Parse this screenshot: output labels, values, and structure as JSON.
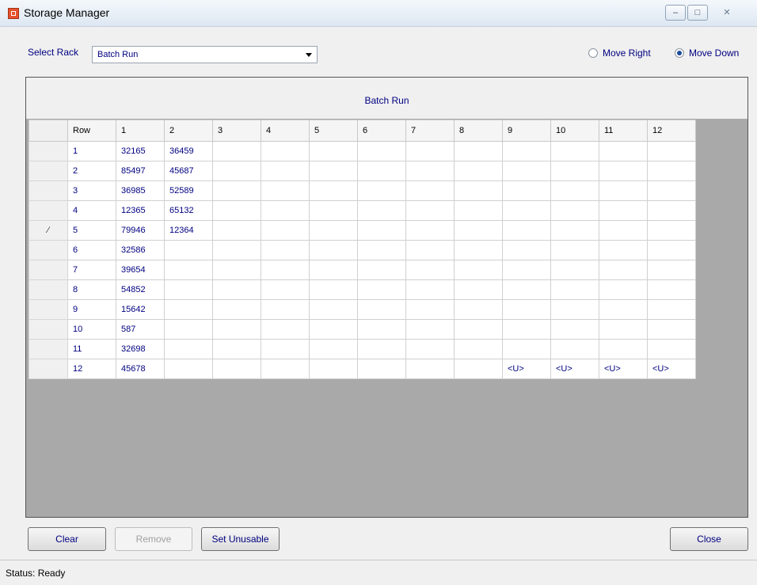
{
  "window": {
    "title": "Storage Manager"
  },
  "controls": {
    "select_rack_label": "Select Rack",
    "rack_value": "Batch Run",
    "move_right_label": "Move Right",
    "move_down_label": "Move Down",
    "selected_direction": "Move Down"
  },
  "grid": {
    "caption": "Batch Run",
    "columns": [
      "Row",
      "1",
      "2",
      "3",
      "4",
      "5",
      "6",
      "7",
      "8",
      "9",
      "10",
      "11",
      "12"
    ],
    "edit_row_index": 4,
    "rows": [
      [
        "1",
        "32165",
        "36459",
        "",
        "",
        "",
        "",
        "",
        "",
        "",
        "",
        "",
        ""
      ],
      [
        "2",
        "85497",
        "45687",
        "",
        "",
        "",
        "",
        "",
        "",
        "",
        "",
        "",
        ""
      ],
      [
        "3",
        "36985",
        "52589",
        "",
        "",
        "",
        "",
        "",
        "",
        "",
        "",
        "",
        ""
      ],
      [
        "4",
        "12365",
        "65132",
        "",
        "",
        "",
        "",
        "",
        "",
        "",
        "",
        "",
        ""
      ],
      [
        "5",
        "79946",
        "12364",
        "",
        "",
        "",
        "",
        "",
        "",
        "",
        "",
        "",
        ""
      ],
      [
        "6",
        "32586",
        "",
        "",
        "",
        "",
        "",
        "",
        "",
        "",
        "",
        "",
        ""
      ],
      [
        "7",
        "39654",
        "",
        "",
        "",
        "",
        "",
        "",
        "",
        "",
        "",
        "",
        ""
      ],
      [
        "8",
        "54852",
        "",
        "",
        "",
        "",
        "",
        "",
        "",
        "",
        "",
        "",
        ""
      ],
      [
        "9",
        "15642",
        "",
        "",
        "",
        "",
        "",
        "",
        "",
        "",
        "",
        "",
        ""
      ],
      [
        "10",
        "587",
        "",
        "",
        "",
        "",
        "",
        "",
        "",
        "",
        "",
        "",
        ""
      ],
      [
        "11",
        "32698",
        "",
        "",
        "",
        "",
        "",
        "",
        "",
        "",
        "",
        "",
        ""
      ],
      [
        "12",
        "45678",
        "",
        "",
        "",
        "",
        "",
        "",
        "",
        "<U>",
        "<U>",
        "<U>",
        "<U>"
      ]
    ]
  },
  "buttons": {
    "clear": "Clear",
    "remove": "Remove",
    "set_unusable": "Set Unusable",
    "close": "Close"
  },
  "status": {
    "text": "Status: Ready"
  },
  "icons": {
    "app": "storage-app-icon",
    "edit_row": "pencil-icon"
  },
  "colors": {
    "text_accent": "#000080",
    "grid_background": "#a9a9a9"
  }
}
